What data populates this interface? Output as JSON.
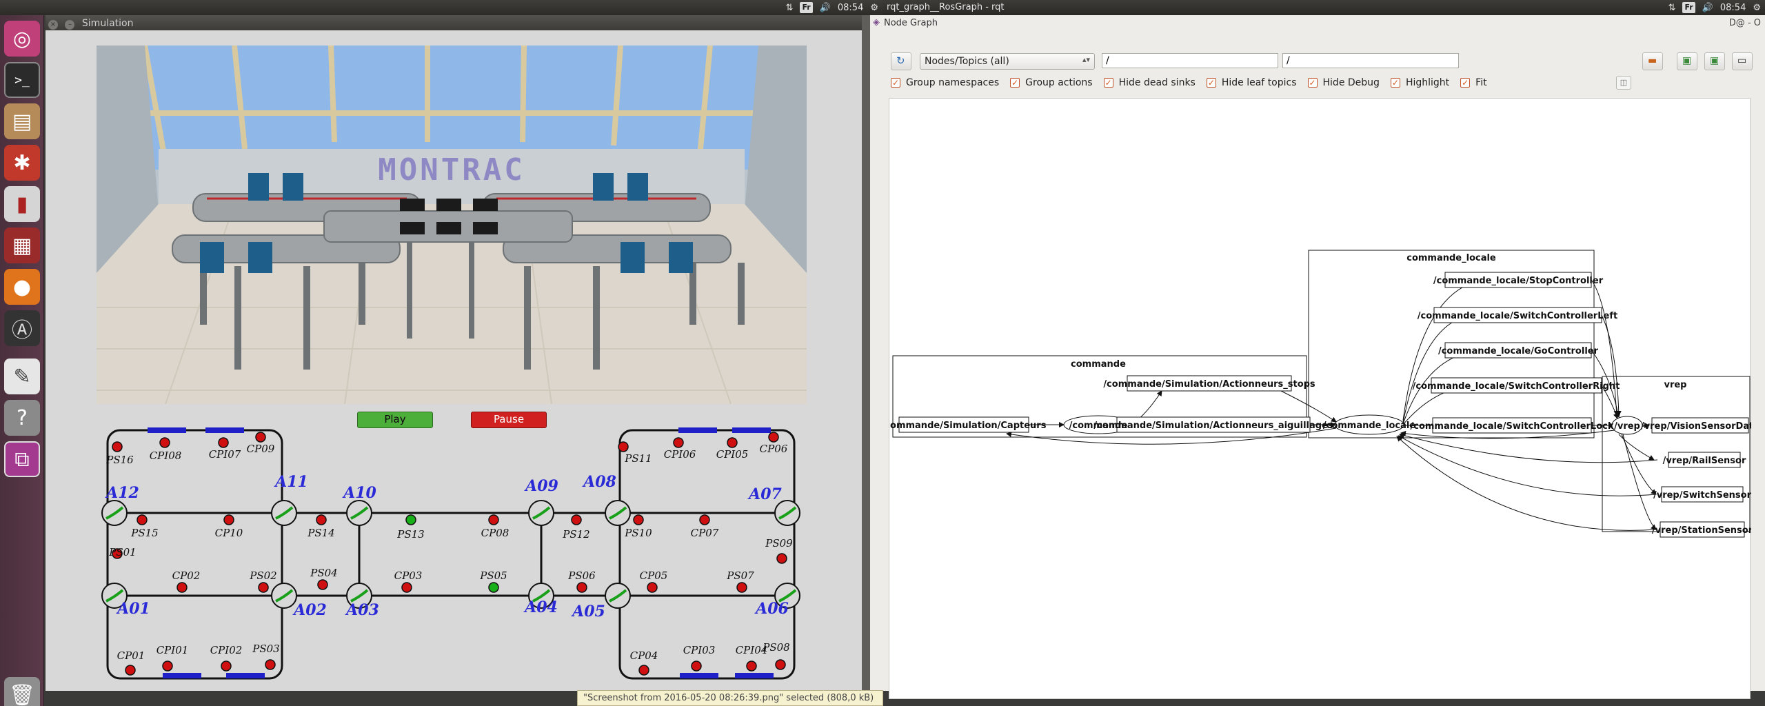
{
  "topbar_left": {
    "time": "08:54",
    "layout_badge": "Fr"
  },
  "topbar_right": {
    "title": "rqt_graph__RosGraph - rqt",
    "time": "08:54",
    "layout_badge": "Fr"
  },
  "simulation": {
    "title": "Simulation",
    "scene_logo": "MONTRAC",
    "play_label": "Play",
    "pause_label": "Pause",
    "map_labels": [
      {
        "text": "PS16",
        "kind": "point"
      },
      {
        "text": "CPI08",
        "kind": "point"
      },
      {
        "text": "CPI07",
        "kind": "point"
      },
      {
        "text": "CP09",
        "kind": "point"
      },
      {
        "text": "A12",
        "kind": "switch"
      },
      {
        "text": "A11",
        "kind": "switch"
      },
      {
        "text": "A10",
        "kind": "switch"
      },
      {
        "text": "A09",
        "kind": "switch"
      },
      {
        "text": "A08",
        "kind": "switch"
      },
      {
        "text": "A07",
        "kind": "switch"
      },
      {
        "text": "PS11",
        "kind": "point"
      },
      {
        "text": "CPI06",
        "kind": "point"
      },
      {
        "text": "CPI05",
        "kind": "point"
      },
      {
        "text": "CP06",
        "kind": "point"
      },
      {
        "text": "PS15",
        "kind": "point"
      },
      {
        "text": "CP10",
        "kind": "point"
      },
      {
        "text": "PS14",
        "kind": "point"
      },
      {
        "text": "PS13",
        "kind": "point"
      },
      {
        "text": "CP08",
        "kind": "point"
      },
      {
        "text": "PS12",
        "kind": "point"
      },
      {
        "text": "PS10",
        "kind": "point"
      },
      {
        "text": "CP07",
        "kind": "point"
      },
      {
        "text": "PS01",
        "kind": "point"
      },
      {
        "text": "PS09",
        "kind": "point"
      },
      {
        "text": "CP02",
        "kind": "point"
      },
      {
        "text": "PS02",
        "kind": "point"
      },
      {
        "text": "PS04",
        "kind": "point"
      },
      {
        "text": "CP03",
        "kind": "point"
      },
      {
        "text": "PS05",
        "kind": "point"
      },
      {
        "text": "PS06",
        "kind": "point"
      },
      {
        "text": "CP05",
        "kind": "point"
      },
      {
        "text": "PS07",
        "kind": "point"
      },
      {
        "text": "A01",
        "kind": "switch"
      },
      {
        "text": "A02",
        "kind": "switch"
      },
      {
        "text": "A03",
        "kind": "switch"
      },
      {
        "text": "A04",
        "kind": "switch"
      },
      {
        "text": "A05",
        "kind": "switch"
      },
      {
        "text": "A06",
        "kind": "switch"
      },
      {
        "text": "CP01",
        "kind": "point"
      },
      {
        "text": "CPI01",
        "kind": "point"
      },
      {
        "text": "CPI02",
        "kind": "point"
      },
      {
        "text": "PS03",
        "kind": "point"
      },
      {
        "text": "CP04",
        "kind": "point"
      },
      {
        "text": "CPI03",
        "kind": "point"
      },
      {
        "text": "CPI04",
        "kind": "point"
      },
      {
        "text": "PS08",
        "kind": "point"
      }
    ]
  },
  "rqt": {
    "panel_title": "Node Graph",
    "panel_corner": "D@ - O",
    "filter_mode": "Nodes/Topics (all)",
    "filter_ns": "/",
    "filter_topics": "/",
    "checkboxes": [
      "Group namespaces",
      "Group actions",
      "Hide dead sinks",
      "Hide leaf topics",
      "Hide Debug",
      "Highlight",
      "Fit"
    ],
    "clusters": {
      "commande": "commande",
      "commande_locale": "commande_locale",
      "vrep": "vrep"
    },
    "nodes": {
      "capteurs": "/commande/Simulation/Capteurs",
      "commande": "/commande",
      "act_stops": "/commande/Simulation/Actionneurs_stops",
      "act_aiguillages": "/commande/Simulation/Actionneurs_aiguillages",
      "commande_locale": "/commande_locale",
      "stop": "/commande_locale/StopController",
      "switch_left": "/commande_locale/SwitchControllerLeft",
      "go": "/commande_locale/GoController",
      "switch_right": "/commande_locale/SwitchControllerRight",
      "switch_lock": "/commande_locale/SwitchControllerLock",
      "vrep": "/vrep",
      "vision": "/vrep/VisionSensorData",
      "rail": "/vrep/RailSensor",
      "switch_sensor": "/vrep/SwitchSensor",
      "station": "/vrep/StationSensor"
    }
  },
  "status_tooltip": "\"Screenshot from 2016-05-20 08:26:39.png\" selected (808,0 kB)",
  "colors": {
    "accent_orange": "#d2591f",
    "switch_blue": "#2a2ad6",
    "track": "#111111",
    "point_red": "#d01010",
    "point_green": "#18b018"
  }
}
